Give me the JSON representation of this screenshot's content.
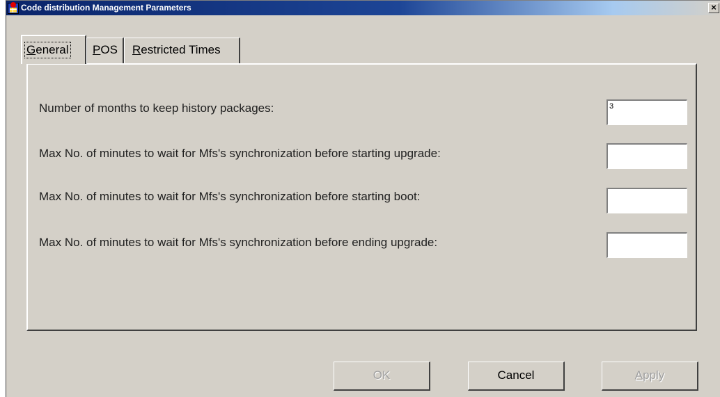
{
  "window": {
    "title": "Code distribution Management Parameters"
  },
  "tabs": [
    {
      "label": "General",
      "active": true
    },
    {
      "label": "POS",
      "active": false
    },
    {
      "label": "Restricted Times",
      "active": false
    }
  ],
  "fields": [
    {
      "label": "Number of months to keep history packages:",
      "value": "3"
    },
    {
      "label": "Max No. of minutes to wait for Mfs's synchronization before starting upgrade:",
      "value": ""
    },
    {
      "label": "Max No. of minutes to wait for Mfs's synchronization before starting boot:",
      "value": ""
    },
    {
      "label": "Max No. of minutes to wait for Mfs's synchronization before ending upgrade:",
      "value": ""
    }
  ],
  "buttons": {
    "ok": {
      "label": "OK",
      "enabled": false
    },
    "cancel": {
      "label": "Cancel",
      "enabled": true
    },
    "apply": {
      "label": "Apply",
      "enabled": false
    }
  },
  "icons": {
    "close": "close-icon",
    "app": "app-icon"
  }
}
